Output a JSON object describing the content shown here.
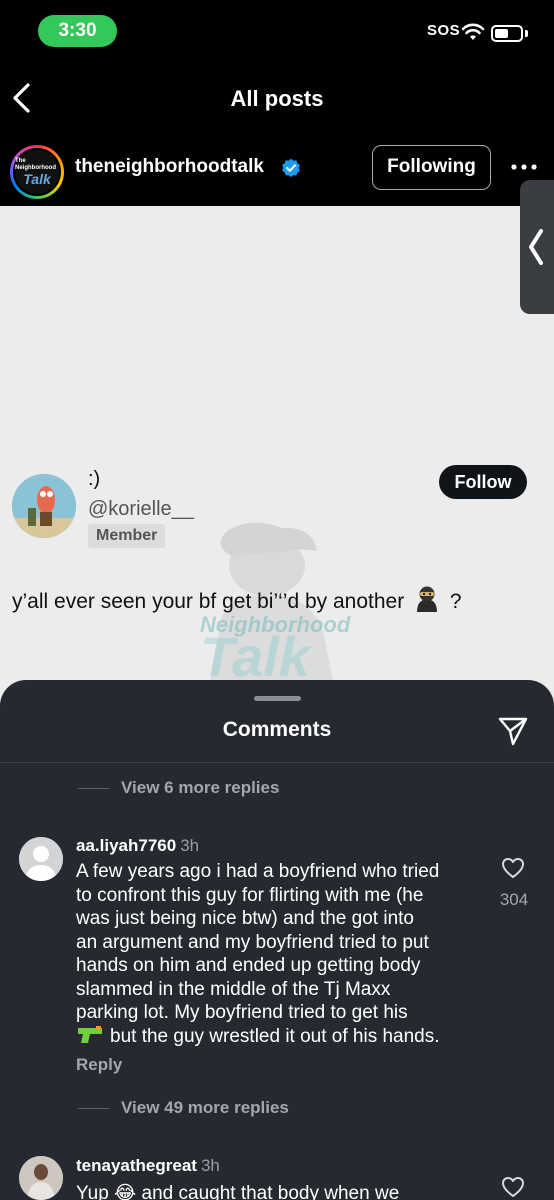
{
  "status_bar": {
    "time": "3:30",
    "sos": "SOS"
  },
  "nav": {
    "title": "All posts"
  },
  "account": {
    "username": "theneighborhoodtalk",
    "following_label": "Following",
    "avatar_small_text": "The Neighborhood",
    "avatar_big_text": "Talk"
  },
  "post": {
    "display_name": ":)",
    "handle": "@korielle__",
    "badge": "Member",
    "follow_label": "Follow",
    "text": "y’all ever seen your bf get bi’‘’d by another",
    "text_end": "?",
    "watermark_top": "Neighborhood",
    "watermark_main": "Talk"
  },
  "comments_sheet": {
    "title": "Comments",
    "view_more_1": "View 6 more replies",
    "view_more_2": "View 49 more replies",
    "comments": [
      {
        "user": "aa.liyah7760",
        "time": "3h",
        "lines": [
          "A few years ago i had a boyfriend who tried",
          "to confront this guy for flirting with me (he",
          "was just being nice btw) and the got into",
          "an argument and my boyfriend tried to put",
          "hands on him and ended up getting body",
          "slammed in the middle of the Tj Maxx",
          "parking lot. My boyfriend tried to get his",
          "but the guy wrestled it out of his hands."
        ],
        "likes": "304",
        "reply_label": "Reply"
      },
      {
        "user": "tenayathegreat",
        "time": "3h",
        "text": "Yup 😂 and caught that body when we"
      }
    ]
  },
  "colors": {
    "accent_green": "#34c759",
    "sheet_bg": "#262a30",
    "verified_blue": "#1d9bf0"
  }
}
